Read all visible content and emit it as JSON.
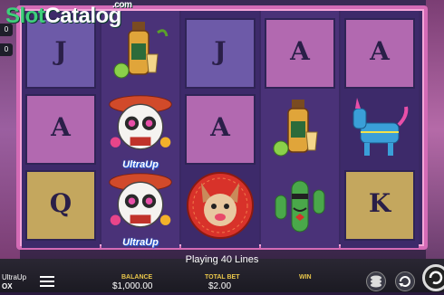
{
  "branding": {
    "logo_slot": "Slot",
    "logo_catalog": "Catalog",
    "logo_com": ".com"
  },
  "reels": [
    [
      "J",
      "",
      ""
    ],
    [
      "",
      "A",
      "Q"
    ],
    [
      "J",
      "A",
      ""
    ],
    [
      "A",
      "",
      ""
    ],
    [
      "A",
      "",
      "K"
    ]
  ],
  "symbol_labels": {
    "ultra_up": "UltraUp"
  },
  "status": {
    "message": "Playing 40 Lines"
  },
  "footer": {
    "brand_line1": "UltraUp",
    "brand_line2": "OX",
    "balance_label": "BALANCE",
    "balance_value": "$1,000.00",
    "total_bet_label": "TOTAL BET",
    "total_bet_value": "$2.00",
    "win_label": "WIN",
    "win_value": ""
  },
  "side_tabs": {
    "tab1": "0",
    "tab2": "0"
  },
  "colors": {
    "frame": "#d46bb6",
    "label": "#e9c64a",
    "logo_green": "#3fcf7b"
  }
}
